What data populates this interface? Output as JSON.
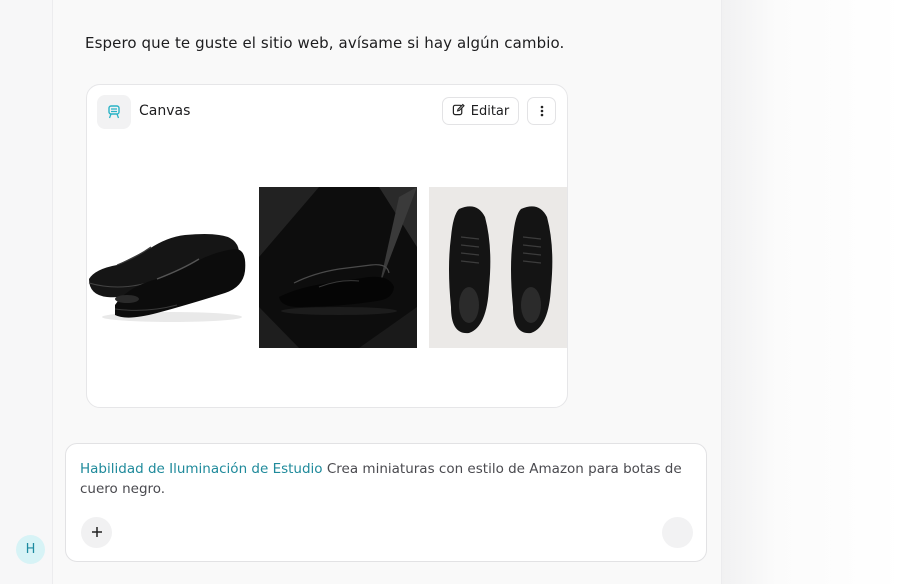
{
  "chat": {
    "assistant_message": "Espero que te guste el sitio web, avísame si hay algún cambio."
  },
  "canvas": {
    "title": "Canvas",
    "edit_label": "Editar",
    "icons": {
      "canvas": "canvas-icon",
      "edit": "pencil-edit-icon",
      "more": "more-vertical-icon"
    },
    "images": [
      {
        "name": "oxford-shoes-image"
      },
      {
        "name": "shoes-dark-backdrop-image"
      },
      {
        "name": "shoes-top-view-image"
      }
    ]
  },
  "composer": {
    "skill_label": "Habilidad de Iluminación de Estudio",
    "prompt_text": "Crea miniaturas con estilo de Amazon para botas de cuero negro.",
    "icons": {
      "add": "plus-icon",
      "send": "send-icon"
    }
  },
  "user": {
    "avatar_initial": "H"
  },
  "colors": {
    "accent": "#1f8a9b",
    "avatar_bg": "#d7f3f6"
  }
}
